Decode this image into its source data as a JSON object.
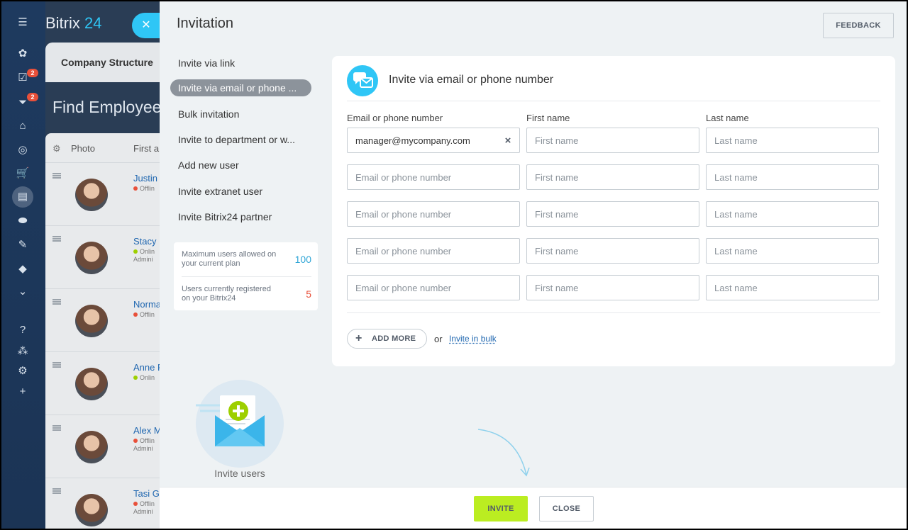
{
  "app": {
    "logo_name": "Bitrix",
    "logo_accent": "24"
  },
  "sidebar": {
    "task_badge": "2",
    "filter_badge": "2"
  },
  "background": {
    "tab": "Company Structure",
    "title": "Find Employee",
    "table_headers": {
      "photo": "Photo",
      "first_name": "First a"
    },
    "rows": [
      {
        "name": "Justin",
        "status": "Offlin",
        "role": "",
        "status_color": "#e8503a"
      },
      {
        "name": "Stacy",
        "status": "Onlin",
        "role": "Admini",
        "status_color": "#9dcf00"
      },
      {
        "name": "Norma",
        "status": "Offlin",
        "role": "",
        "status_color": "#e8503a"
      },
      {
        "name": "Anne F",
        "status": "Onlin",
        "role": "",
        "status_color": "#9dcf00"
      },
      {
        "name": "Alex M",
        "status": "Offlin",
        "role": "Admini",
        "status_color": "#e8503a"
      },
      {
        "name": "Tasi G",
        "status": "Offlin",
        "role": "Admini",
        "status_color": "#e8503a"
      }
    ]
  },
  "panel": {
    "title": "Invitation",
    "feedback_label": "FEEDBACK",
    "menu": [
      "Invite via link",
      "Invite via email or phone ...",
      "Bulk invitation",
      "Invite to department or w...",
      "Add new user",
      "Invite extranet user",
      "Invite Bitrix24 partner"
    ],
    "stats": [
      {
        "label": "Maximum users allowed on your current plan",
        "value": "100",
        "color": "#2fa5d6"
      },
      {
        "label": "Users currently registered on your Bitrix24",
        "value": "5",
        "color": "#e8503a"
      }
    ],
    "illustration_label": "Invite users"
  },
  "form": {
    "title": "Invite via email or phone number",
    "col_email": "Email or phone number",
    "col_first": "First name",
    "col_last": "Last name",
    "rows": [
      {
        "email_value": "manager@mycompany.com",
        "email_placeholder": "Email or phone number",
        "first_placeholder": "First name",
        "last_placeholder": "Last name"
      },
      {
        "email_value": "",
        "email_placeholder": "Email or phone number",
        "first_placeholder": "First name",
        "last_placeholder": "Last name"
      },
      {
        "email_value": "",
        "email_placeholder": "Email or phone number",
        "first_placeholder": "First name",
        "last_placeholder": "Last name"
      },
      {
        "email_value": "",
        "email_placeholder": "Email or phone number",
        "first_placeholder": "First name",
        "last_placeholder": "Last name"
      },
      {
        "email_value": "",
        "email_placeholder": "Email or phone number",
        "first_placeholder": "First name",
        "last_placeholder": "Last name"
      }
    ],
    "add_more_label": "ADD MORE",
    "or_text": "or",
    "bulk_link": "Invite in bulk"
  },
  "footer": {
    "invite_label": "INVITE",
    "close_label": "CLOSE"
  },
  "colors": {
    "accent": "#2fc6f6",
    "invite_green": "#bbed21",
    "sidebar": "#1e3a5f"
  }
}
